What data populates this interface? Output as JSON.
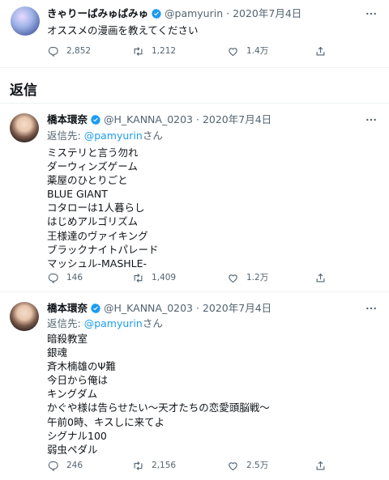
{
  "main_tweet": {
    "display_name": "きゃりーぱみゅぱみゅ",
    "handle": "@pamyurin",
    "date": "2020年7月4日",
    "text": "オススメの漫画を教えてください",
    "stats": {
      "replies": "2,852",
      "retweets": "1,212",
      "likes": "1.4万"
    }
  },
  "replies_section": {
    "title": "返信"
  },
  "replies": [
    {
      "display_name": "橋本環奈",
      "handle": "@H_KANNA_0203",
      "date": "2020年7月4日",
      "reply_to_label": "返信先: ",
      "reply_to_handle": "@pamyurin",
      "reply_to_suffix": "さん",
      "lines": [
        "ミステリと言う勿れ",
        "ダーウィンズゲーム",
        "薬屋のひとりごと",
        "BLUE GIANT",
        "コタローは1人暮らし",
        "はじめアルゴリズム",
        "王様達のヴァイキング",
        "ブラックナイトパレード",
        "マッシュル-MASHLE-"
      ],
      "stats": {
        "replies": "146",
        "retweets": "1,409",
        "likes": "1.2万"
      }
    },
    {
      "display_name": "橋本環奈",
      "handle": "@H_KANNA_0203",
      "date": "2020年7月4日",
      "reply_to_label": "返信先: ",
      "reply_to_handle": "@pamyurin",
      "reply_to_suffix": "さん",
      "lines": [
        "暗殺教室",
        "銀魂",
        "斉木楠雄のΨ難",
        "今日から俺は",
        "キングダム",
        "かぐや様は告らせたい〜天才たちの恋愛頭脳戦〜",
        "午前0時、キスしに来てよ",
        "シグナル100",
        "弱虫ペダル"
      ],
      "stats": {
        "replies": "246",
        "retweets": "2,156",
        "likes": "2.5万"
      }
    }
  ],
  "icons": {
    "verified": "verified-badge-icon",
    "reply": "reply-icon",
    "retweet": "retweet-icon",
    "like": "heart-icon",
    "share": "share-icon",
    "more": "more-icon"
  },
  "colors": {
    "accent": "#1d9bf0",
    "muted": "#536471",
    "text": "#0f1419",
    "divider": "#eff3f4"
  }
}
